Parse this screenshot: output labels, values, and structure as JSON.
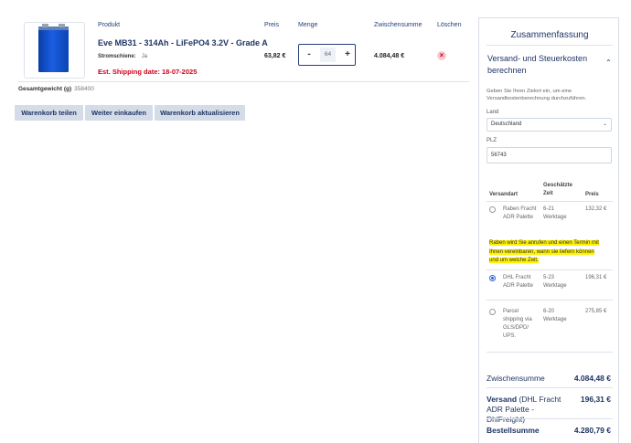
{
  "cart": {
    "headers": {
      "product": "Produkt",
      "price": "Preis",
      "quantity": "Menge",
      "subtotal": "Zwischensumme",
      "delete": "Löschen"
    },
    "item": {
      "name": "Eve MB31 - 314Ah - LiFePO4 3.2V - Grade A",
      "meta_label": "Stromschiene:",
      "meta_value": "Ja",
      "shipping": "Est. Shipping date: 18-07-2025",
      "price": "63,82 €",
      "quantity": "64",
      "minus": "-",
      "plus": "+",
      "subtotal": "4.084,48 €",
      "delete_icon": "×"
    },
    "weight_label": "Gesamtgewicht (g)",
    "weight_value": "358400",
    "buttons": {
      "share": "Warenkorb teilen",
      "continue": "Weiter einkaufen",
      "update": "Warenkorb aktualisieren"
    }
  },
  "summary": {
    "title": "Zusammenfassung",
    "section_title": "Versand- und Steuerkosten berechnen",
    "chevron": "⌃",
    "intro": "Geben Sie Ihren Zielort ein, um eine Versandkostenberechnung durchzuführen.",
    "country_label": "Land",
    "country_value": "Deutschland",
    "select_arrow": "⌄",
    "zip_label": "PLZ",
    "zip_value": "56743",
    "table_headers": {
      "method": "Versandart",
      "time": "Geschätzte Zeit",
      "price": "Preis"
    },
    "methods": [
      {
        "name": "Raben Fracht ADR Palette",
        "time": "6-21 Werktage",
        "price": "132,32 €",
        "selected": false
      },
      {
        "name": "DHL Fracht ADR Palette",
        "time": "5-23 Werktage",
        "price": "196,31 €",
        "selected": true
      },
      {
        "name": "Parcel shipping via GLS/DPD/ UPS.",
        "time": "6-20 Werktage",
        "price": "275,85 €",
        "selected": false
      }
    ],
    "raben_note": "Raben wird Sie anrufen und einen Termin mit Ihnen vereinbaren, wann sie liefern können und um welche Zeit.",
    "subtotal_label": "Zwischensumme",
    "subtotal_value": "4.084,48 €",
    "shipping_label": "Versand",
    "shipping_detail": "(DHL Fracht ADR Palette - DhlFreight)",
    "shipping_value": "196,31 €",
    "total_label": "Bestellsumme",
    "total_value": "4.280,79 €"
  },
  "colors": {
    "accent": "#1f3466",
    "danger": "#d0021b",
    "button_bg": "#d4dce8",
    "highlight": "#fff200"
  }
}
